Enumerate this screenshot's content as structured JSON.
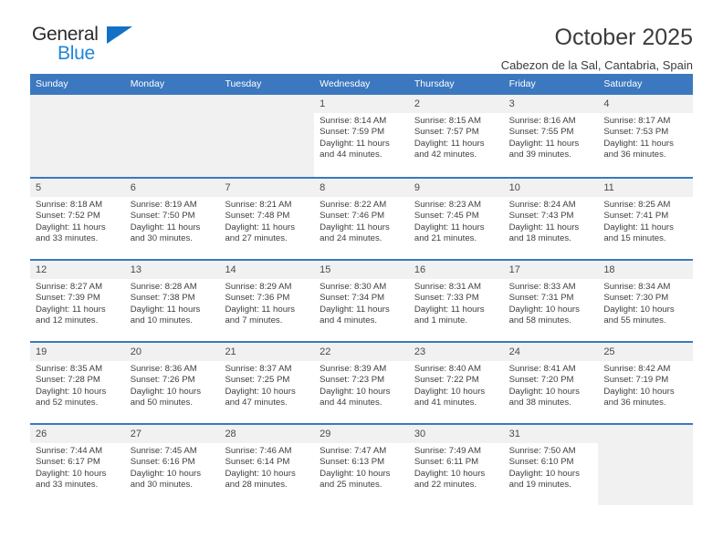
{
  "brand": {
    "name_top": "General",
    "name_bottom": "Blue",
    "accent_color": "#1271c4",
    "blue_text_color": "#1f86d8"
  },
  "header": {
    "title": "October 2025",
    "location": "Cabezon de la Sal, Cantabria, Spain"
  },
  "calendar": {
    "header_bg": "#3b78bf",
    "weekdays": [
      "Sunday",
      "Monday",
      "Tuesday",
      "Wednesday",
      "Thursday",
      "Friday",
      "Saturday"
    ],
    "weeks": [
      [
        {
          "day": "",
          "empty": true
        },
        {
          "day": "",
          "empty": true
        },
        {
          "day": "",
          "empty": true
        },
        {
          "day": "1",
          "sunrise": "Sunrise: 8:14 AM",
          "sunset": "Sunset: 7:59 PM",
          "daylight": "Daylight: 11 hours and 44 minutes."
        },
        {
          "day": "2",
          "sunrise": "Sunrise: 8:15 AM",
          "sunset": "Sunset: 7:57 PM",
          "daylight": "Daylight: 11 hours and 42 minutes."
        },
        {
          "day": "3",
          "sunrise": "Sunrise: 8:16 AM",
          "sunset": "Sunset: 7:55 PM",
          "daylight": "Daylight: 11 hours and 39 minutes."
        },
        {
          "day": "4",
          "sunrise": "Sunrise: 8:17 AM",
          "sunset": "Sunset: 7:53 PM",
          "daylight": "Daylight: 11 hours and 36 minutes."
        }
      ],
      [
        {
          "day": "5",
          "sunrise": "Sunrise: 8:18 AM",
          "sunset": "Sunset: 7:52 PM",
          "daylight": "Daylight: 11 hours and 33 minutes."
        },
        {
          "day": "6",
          "sunrise": "Sunrise: 8:19 AM",
          "sunset": "Sunset: 7:50 PM",
          "daylight": "Daylight: 11 hours and 30 minutes."
        },
        {
          "day": "7",
          "sunrise": "Sunrise: 8:21 AM",
          "sunset": "Sunset: 7:48 PM",
          "daylight": "Daylight: 11 hours and 27 minutes."
        },
        {
          "day": "8",
          "sunrise": "Sunrise: 8:22 AM",
          "sunset": "Sunset: 7:46 PM",
          "daylight": "Daylight: 11 hours and 24 minutes."
        },
        {
          "day": "9",
          "sunrise": "Sunrise: 8:23 AM",
          "sunset": "Sunset: 7:45 PM",
          "daylight": "Daylight: 11 hours and 21 minutes."
        },
        {
          "day": "10",
          "sunrise": "Sunrise: 8:24 AM",
          "sunset": "Sunset: 7:43 PM",
          "daylight": "Daylight: 11 hours and 18 minutes."
        },
        {
          "day": "11",
          "sunrise": "Sunrise: 8:25 AM",
          "sunset": "Sunset: 7:41 PM",
          "daylight": "Daylight: 11 hours and 15 minutes."
        }
      ],
      [
        {
          "day": "12",
          "sunrise": "Sunrise: 8:27 AM",
          "sunset": "Sunset: 7:39 PM",
          "daylight": "Daylight: 11 hours and 12 minutes."
        },
        {
          "day": "13",
          "sunrise": "Sunrise: 8:28 AM",
          "sunset": "Sunset: 7:38 PM",
          "daylight": "Daylight: 11 hours and 10 minutes."
        },
        {
          "day": "14",
          "sunrise": "Sunrise: 8:29 AM",
          "sunset": "Sunset: 7:36 PM",
          "daylight": "Daylight: 11 hours and 7 minutes."
        },
        {
          "day": "15",
          "sunrise": "Sunrise: 8:30 AM",
          "sunset": "Sunset: 7:34 PM",
          "daylight": "Daylight: 11 hours and 4 minutes."
        },
        {
          "day": "16",
          "sunrise": "Sunrise: 8:31 AM",
          "sunset": "Sunset: 7:33 PM",
          "daylight": "Daylight: 11 hours and 1 minute."
        },
        {
          "day": "17",
          "sunrise": "Sunrise: 8:33 AM",
          "sunset": "Sunset: 7:31 PM",
          "daylight": "Daylight: 10 hours and 58 minutes."
        },
        {
          "day": "18",
          "sunrise": "Sunrise: 8:34 AM",
          "sunset": "Sunset: 7:30 PM",
          "daylight": "Daylight: 10 hours and 55 minutes."
        }
      ],
      [
        {
          "day": "19",
          "sunrise": "Sunrise: 8:35 AM",
          "sunset": "Sunset: 7:28 PM",
          "daylight": "Daylight: 10 hours and 52 minutes."
        },
        {
          "day": "20",
          "sunrise": "Sunrise: 8:36 AM",
          "sunset": "Sunset: 7:26 PM",
          "daylight": "Daylight: 10 hours and 50 minutes."
        },
        {
          "day": "21",
          "sunrise": "Sunrise: 8:37 AM",
          "sunset": "Sunset: 7:25 PM",
          "daylight": "Daylight: 10 hours and 47 minutes."
        },
        {
          "day": "22",
          "sunrise": "Sunrise: 8:39 AM",
          "sunset": "Sunset: 7:23 PM",
          "daylight": "Daylight: 10 hours and 44 minutes."
        },
        {
          "day": "23",
          "sunrise": "Sunrise: 8:40 AM",
          "sunset": "Sunset: 7:22 PM",
          "daylight": "Daylight: 10 hours and 41 minutes."
        },
        {
          "day": "24",
          "sunrise": "Sunrise: 8:41 AM",
          "sunset": "Sunset: 7:20 PM",
          "daylight": "Daylight: 10 hours and 38 minutes."
        },
        {
          "day": "25",
          "sunrise": "Sunrise: 8:42 AM",
          "sunset": "Sunset: 7:19 PM",
          "daylight": "Daylight: 10 hours and 36 minutes."
        }
      ],
      [
        {
          "day": "26",
          "sunrise": "Sunrise: 7:44 AM",
          "sunset": "Sunset: 6:17 PM",
          "daylight": "Daylight: 10 hours and 33 minutes."
        },
        {
          "day": "27",
          "sunrise": "Sunrise: 7:45 AM",
          "sunset": "Sunset: 6:16 PM",
          "daylight": "Daylight: 10 hours and 30 minutes."
        },
        {
          "day": "28",
          "sunrise": "Sunrise: 7:46 AM",
          "sunset": "Sunset: 6:14 PM",
          "daylight": "Daylight: 10 hours and 28 minutes."
        },
        {
          "day": "29",
          "sunrise": "Sunrise: 7:47 AM",
          "sunset": "Sunset: 6:13 PM",
          "daylight": "Daylight: 10 hours and 25 minutes."
        },
        {
          "day": "30",
          "sunrise": "Sunrise: 7:49 AM",
          "sunset": "Sunset: 6:11 PM",
          "daylight": "Daylight: 10 hours and 22 minutes."
        },
        {
          "day": "31",
          "sunrise": "Sunrise: 7:50 AM",
          "sunset": "Sunset: 6:10 PM",
          "daylight": "Daylight: 10 hours and 19 minutes."
        },
        {
          "day": "",
          "empty": true
        }
      ]
    ]
  }
}
